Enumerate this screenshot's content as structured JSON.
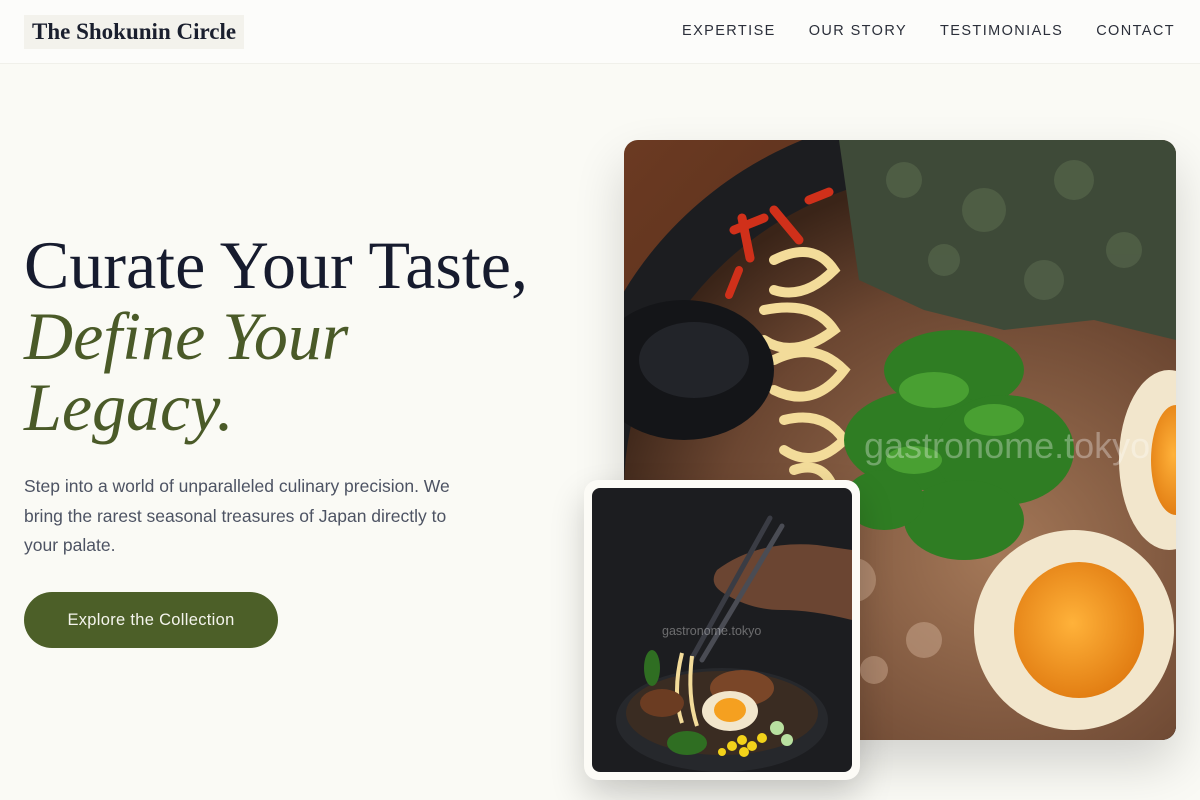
{
  "header": {
    "brand": "The Shokunin Circle",
    "nav": [
      "EXPERTISE",
      "OUR STORY",
      "TESTIMONIALS",
      "CONTACT"
    ]
  },
  "hero": {
    "title_line1": "Curate Your Taste,",
    "title_line2": "Define Your",
    "title_line3": "Legacy.",
    "description": "Step into a world of unparalleled culinary precision. We bring the rarest seasonal treasures of Japan directly to your palate.",
    "cta_label": "Explore the Collection"
  },
  "images": {
    "main_watermark": "gastronome.tokyo",
    "small_watermark": "gastronome.tokyo"
  },
  "colors": {
    "background": "#fafaf5",
    "accent_green": "#4c5f28",
    "heading": "#161b2e"
  }
}
